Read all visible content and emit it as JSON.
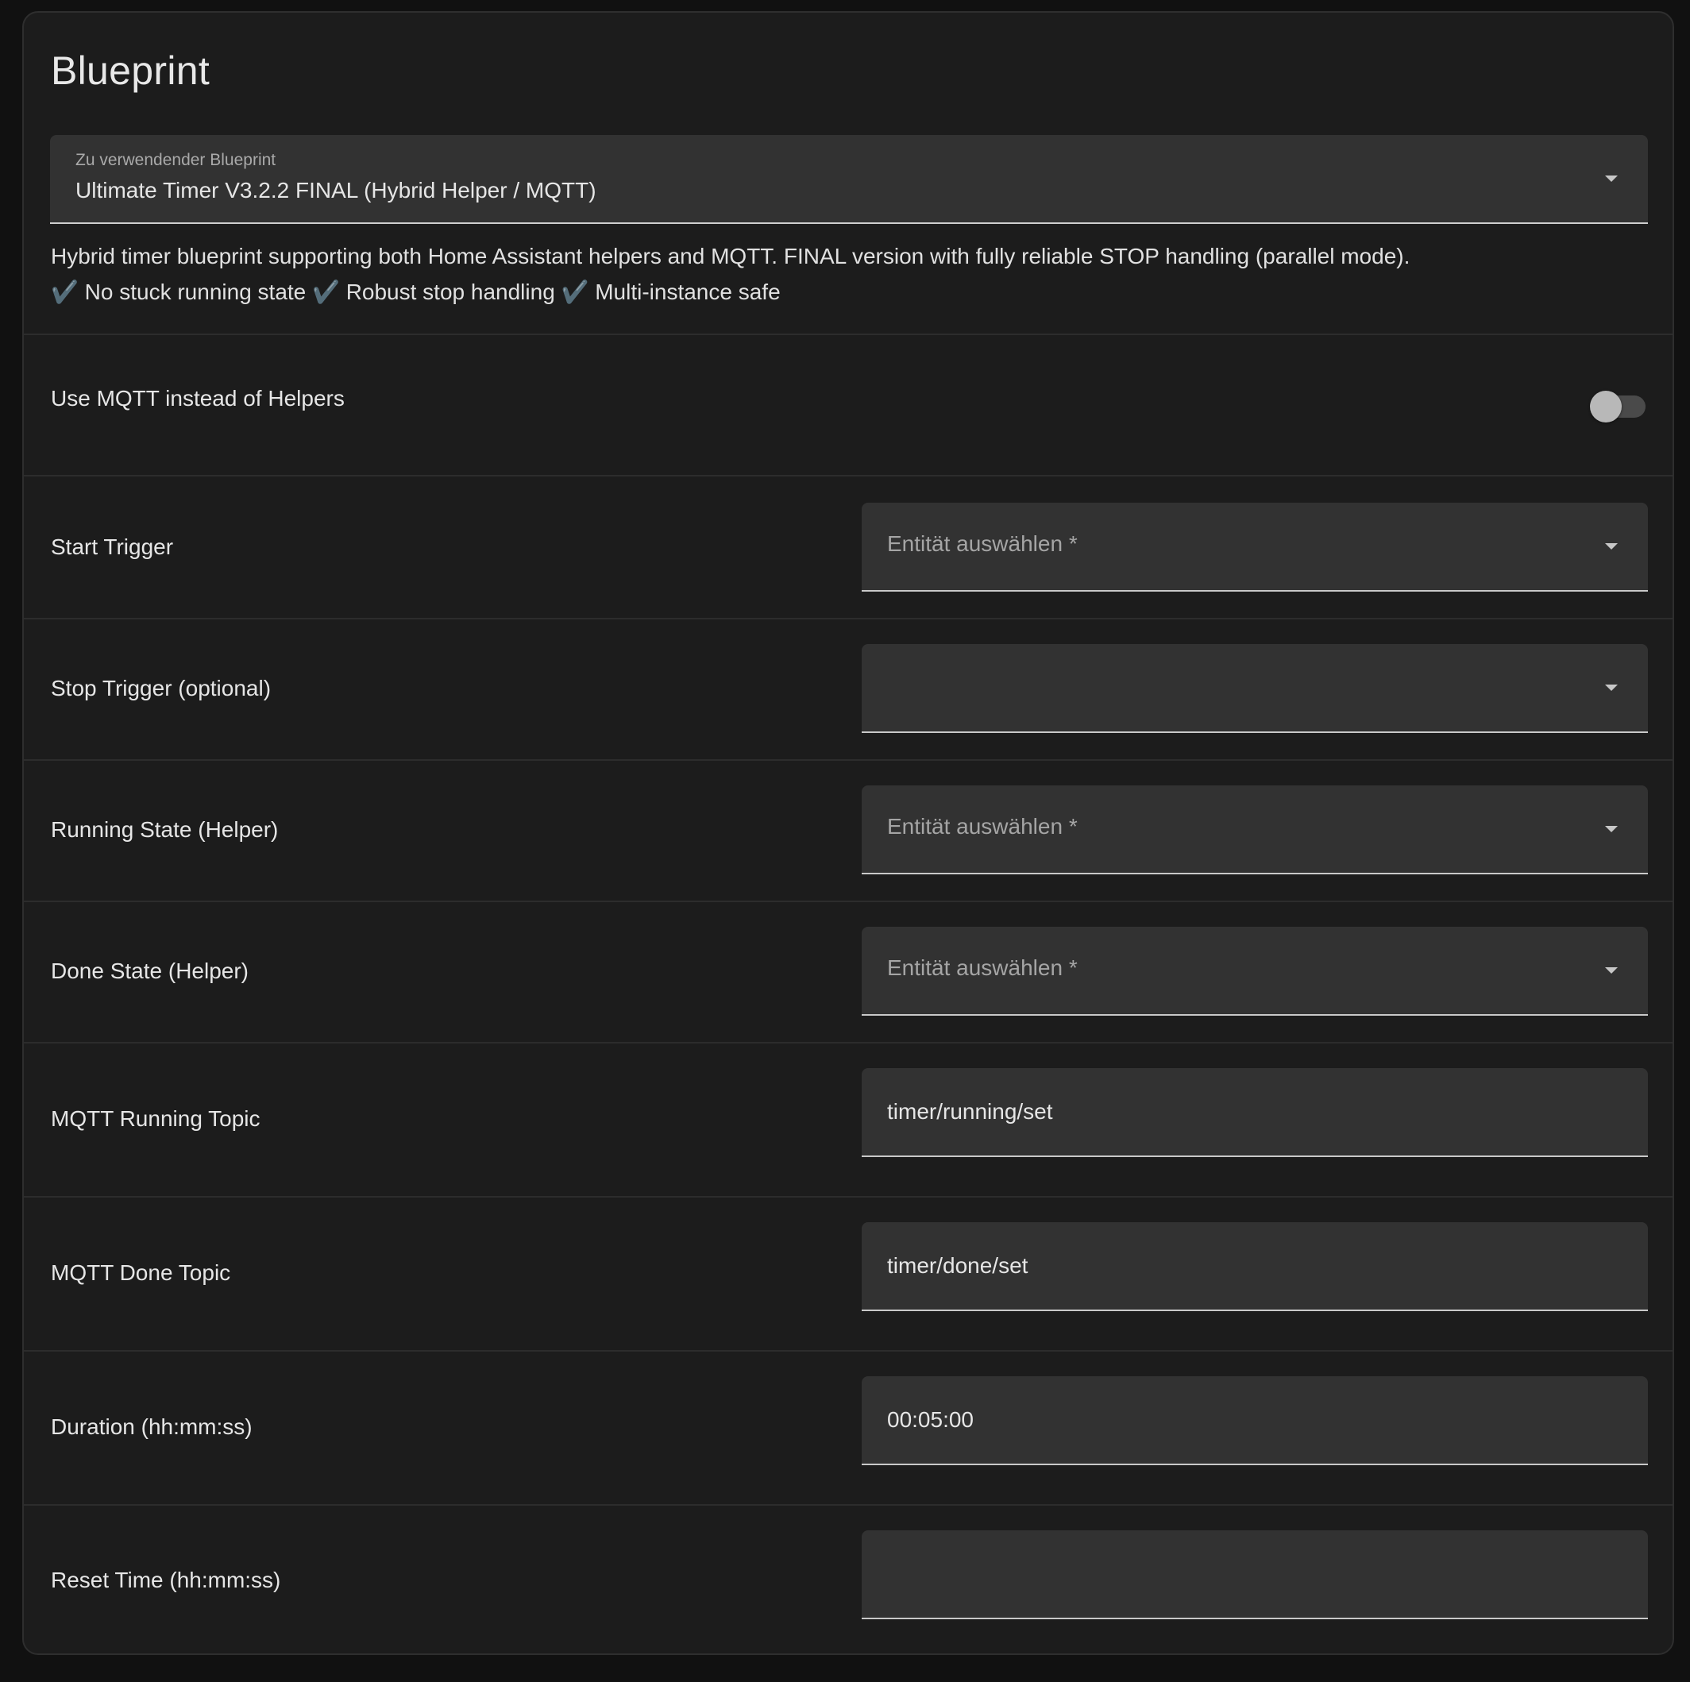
{
  "card": {
    "title": "Blueprint"
  },
  "blueprint_select": {
    "label": "Zu verwendender Blueprint",
    "value": "Ultimate Timer V3.2.2 FINAL (Hybrid Helper / MQTT)"
  },
  "description": {
    "line1": "Hybrid timer blueprint supporting both Home Assistant helpers and MQTT. FINAL version with fully reliable STOP handling (parallel mode).",
    "check_mark": "✔️",
    "features": [
      "No stuck running state",
      "Robust stop handling",
      "Multi-instance safe"
    ]
  },
  "toggle_row": {
    "label": "Use MQTT instead of Helpers",
    "checked": false
  },
  "rows": [
    {
      "label": "Start Trigger",
      "kind": "entity",
      "placeholder": "Entität auswählen *",
      "value": ""
    },
    {
      "label": "Stop Trigger (optional)",
      "kind": "entity",
      "placeholder": "",
      "value": ""
    },
    {
      "label": "Running State (Helper)",
      "kind": "entity",
      "placeholder": "Entität auswählen *",
      "value": ""
    },
    {
      "label": "Done State (Helper)",
      "kind": "entity",
      "placeholder": "Entität auswählen *",
      "value": ""
    },
    {
      "label": "MQTT Running Topic",
      "kind": "text",
      "placeholder": "",
      "value": "timer/running/set"
    },
    {
      "label": "MQTT Done Topic",
      "kind": "text",
      "placeholder": "",
      "value": "timer/done/set"
    },
    {
      "label": "Duration (hh:mm:ss)",
      "kind": "text",
      "placeholder": "",
      "value": "00:05:00"
    },
    {
      "label": "Reset Time (hh:mm:ss)",
      "kind": "text",
      "placeholder": "",
      "value": ""
    }
  ],
  "colors": {
    "background": "#111111",
    "card": "#1c1c1c",
    "field": "#323232",
    "check_mark": "#7fa8c9"
  }
}
